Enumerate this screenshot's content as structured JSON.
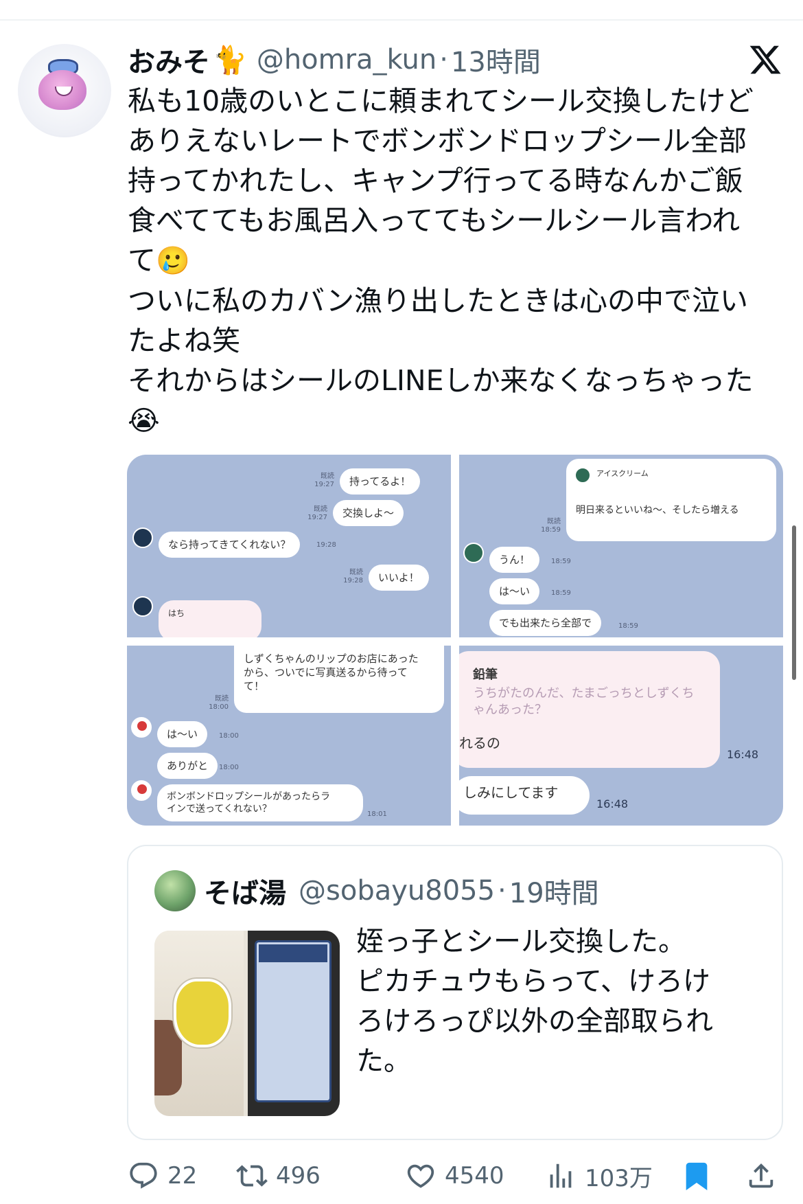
{
  "author": {
    "name": "おみそ",
    "name_emoji": "🐈",
    "handle": "@homra_kun",
    "separator": "·",
    "time": "13時間"
  },
  "post": {
    "text_lines": [
      "私も10歳のいとこに頼まれてシール交換したけど",
      "ありえないレートでボンボンドロップシール全部",
      "持ってかれたし、キャンプ行ってる時なんかご飯",
      "食べててもお風呂入っててもシールシール言われ",
      "て"
    ],
    "emoji_1": "🥲",
    "text_lines_2": [
      "ついに私のカバン漁り出したときは心の中で泣い",
      "たよね笑",
      "それからはシールのLINEしか来なくなっちゃった"
    ],
    "emoji_2": "😭"
  },
  "media": {
    "panel1": {
      "msgs": [
        {
          "text": "持ってるよ！",
          "meta": "既読\n19:27"
        },
        {
          "text": "交換しよ〜",
          "meta": "既読\n19:27"
        },
        {
          "text": "なら持ってきてくれない？",
          "meta": "19:28"
        },
        {
          "text": "いいよ！",
          "meta": "既読\n19:28"
        },
        {
          "text": "はち",
          "meta": ""
        }
      ]
    },
    "panel2": {
      "msgs": [
        {
          "text": "アイスクリーム",
          "meta": ""
        },
        {
          "text": "明日来るといいね〜、そしたら増える",
          "meta": "既読\n18:59"
        },
        {
          "text": "うん！",
          "meta": "18:59"
        },
        {
          "text": "は〜い",
          "meta": "18:59"
        },
        {
          "text": "でも出来たら全部で",
          "meta": "18:59"
        }
      ]
    },
    "panel3": {
      "msgs": [
        {
          "text": "しずくちゃんのリップのお店にあった\nから、ついでに写真送るから待って\nて！",
          "meta": "既読\n18:00"
        },
        {
          "text": "は〜い",
          "meta": "18:00"
        },
        {
          "text": "ありがと",
          "meta": "18:00"
        },
        {
          "text": "ボンボンドロップシールがあったらラ\nインで送ってくれない？",
          "meta": "18:01"
        }
      ]
    },
    "panel4": {
      "msgs": [
        {
          "text": "鉛筆",
          "meta": ""
        },
        {
          "text": "うちがたのんだ、たまごっちとしずくち\nゃんあった？",
          "meta": ""
        },
        {
          "text": "れるの",
          "meta": "16:48"
        },
        {
          "text": "しみにしてます",
          "meta": "16:48"
        }
      ]
    }
  },
  "quote": {
    "name": "そば湯",
    "handle": "@sobayu8055",
    "separator": "·",
    "time": "19時間",
    "text": "姪っ子とシール交換した。\nピカチュウもらって、けろけ\nろけろっぴ以外の全部取られ\nた。"
  },
  "actions": {
    "replies": "22",
    "reposts": "496",
    "likes": "4540",
    "views": "103万"
  },
  "colors": {
    "accent": "#1d9bf0",
    "muted": "#536471",
    "chat_bg": "#a9bad9"
  }
}
